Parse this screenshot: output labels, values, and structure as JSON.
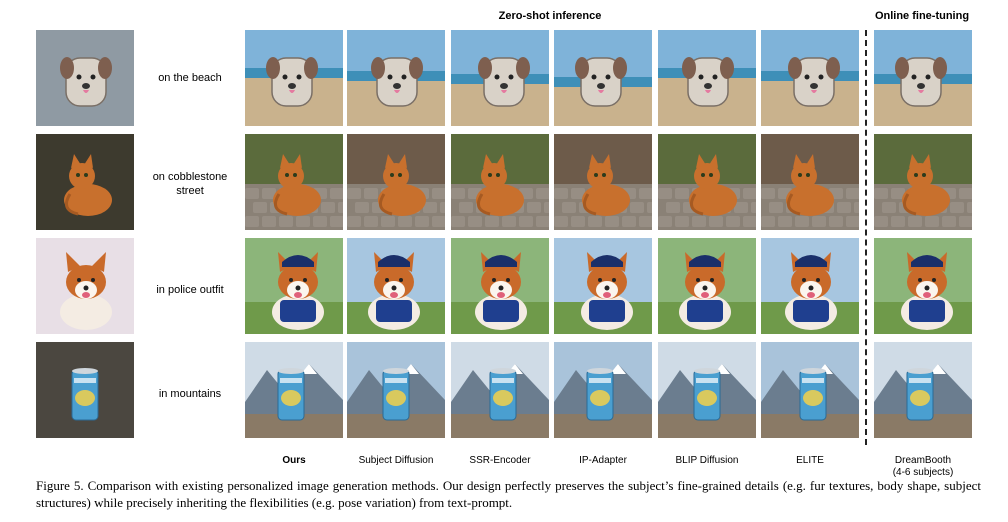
{
  "headers": {
    "zero_shot": "Zero-shot inference",
    "online": "Online fine-tuning"
  },
  "rows": [
    {
      "prompt": "on the beach",
      "subject": "backpack"
    },
    {
      "prompt": "on cobblestone street",
      "subject": "cat"
    },
    {
      "prompt": "in police outfit",
      "subject": "dog"
    },
    {
      "prompt": "in mountains",
      "subject": "can"
    }
  ],
  "columns": [
    {
      "label": "Ours",
      "bold": true
    },
    {
      "label": "Subject Diffusion",
      "bold": false
    },
    {
      "label": "SSR-Encoder",
      "bold": false
    },
    {
      "label": "IP-Adapter",
      "bold": false
    },
    {
      "label": "BLIP Diffusion",
      "bold": false
    },
    {
      "label": "ELITE",
      "bold": false
    },
    {
      "label": "DreamBooth\n(4-6 subjects)",
      "bold": false
    }
  ],
  "caption": {
    "lead": "Figure 5.",
    "text": "Comparison with existing personalized image generation methods. Our design perfectly preserves the subject’s fine-grained details (e.g. fur textures, body shape, subject structures) while precisely inheriting the flexibilities (e.g. pose variation) from text-prompt."
  },
  "colors": {
    "sky": "#7fb3d9",
    "sand": "#c9b28d",
    "stone": "#8a8176",
    "cat": "#c8702d",
    "dog": "#c96a2a",
    "can": "#4a9fd0",
    "police": "#1f3f8f",
    "mountain": "#6b7d8f"
  }
}
